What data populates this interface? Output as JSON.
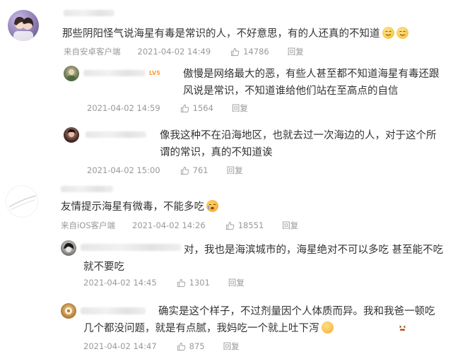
{
  "comments": [
    {
      "text": "那些阴阳怪气说海星有毒是常识的人，不好意思，有的人还真的不知道",
      "source": "来自安卓客户端",
      "date": "2021-04-02 14:49",
      "likes": "14786",
      "reply_label": "回复",
      "replies": [
        {
          "badge": "LV5",
          "text": "傲慢是网络最大的恶，有些人甚至都不知道海星有毒还跟风说是常识，不知道谁给他们站在至高点的自信",
          "date": "2021-04-02 14:59",
          "likes": "1564",
          "reply_label": "回复"
        },
        {
          "text": "像我这种不在沿海地区，也就去过一次海边的人，对于这个所谓的常识，真的不知道诶",
          "date": "2021-04-02 15:00",
          "likes": "761",
          "reply_label": "回复"
        }
      ]
    },
    {
      "text": "友情提示海星有微毒，不能多吃",
      "source": "来自iOS客户端",
      "date": "2021-04-02 14:26",
      "likes": "18551",
      "reply_label": "回复",
      "replies": [
        {
          "text": "对，我也是海滨城市的，海星绝对不可以多吃 甚至能不吃就不要吃",
          "date": "2021-04-02 14:45",
          "likes": "1301",
          "reply_label": "回复"
        },
        {
          "text": "确实是这个样子，不过剂量因个人体质而异。我和我爸一顿吃几个都没问题，就是有点腻，我妈吃一个就上吐下泻",
          "date": "2021-04-02 14:47",
          "likes": "875",
          "reply_label": "回复"
        }
      ]
    }
  ],
  "colors": {
    "text": "#333333",
    "meta": "#999999",
    "badge": "#ff9a3c",
    "emoji": "#f7c948"
  },
  "icons": {
    "like": "thumbs-up-icon",
    "emoji_smile": "smile-emoji-icon",
    "emoji_cry": "crying-emoji-icon",
    "emoji_sick": "sick-emoji-icon"
  }
}
